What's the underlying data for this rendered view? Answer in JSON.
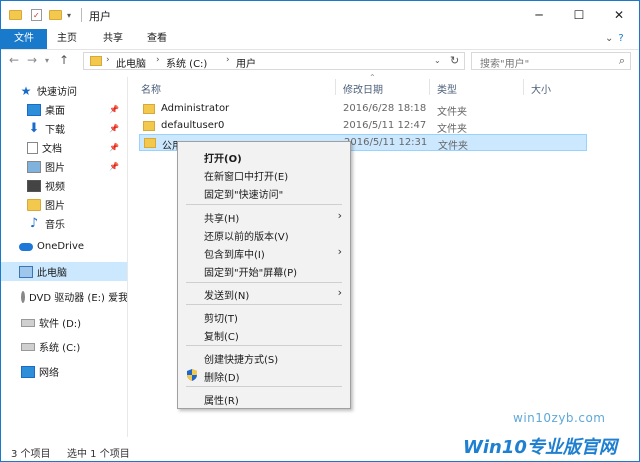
{
  "window": {
    "title": "用户",
    "controls": {
      "minimize": "─",
      "maximize": "☐",
      "close": "✕"
    }
  },
  "ribbon": {
    "tabs": [
      "文件",
      "主页",
      "共享",
      "查看"
    ],
    "expand": "⌄",
    "help": "?"
  },
  "address": {
    "crumbs": [
      "此电脑",
      "系统 (C:)",
      "用户"
    ],
    "search_placeholder": "搜索\"用户\""
  },
  "nav": {
    "items": [
      {
        "label": "快速访问",
        "icon": "star-icon"
      },
      {
        "label": "桌面",
        "icon": "desktop-icon",
        "pinned": true
      },
      {
        "label": "下载",
        "icon": "download-icon",
        "pinned": true
      },
      {
        "label": "文档",
        "icon": "documents-icon",
        "pinned": true
      },
      {
        "label": "图片",
        "icon": "pictures-icon",
        "pinned": true
      },
      {
        "label": "视频",
        "icon": "video-icon"
      },
      {
        "label": "图片",
        "icon": "folder-icon"
      },
      {
        "label": "音乐",
        "icon": "music-icon"
      },
      {
        "label": "OneDrive",
        "icon": "cloud-icon"
      },
      {
        "label": "此电脑",
        "icon": "computer-icon",
        "selected": true
      },
      {
        "label": "DVD 驱动器 (E:) 爱我",
        "icon": "dvd-icon"
      },
      {
        "label": "软件 (D:)",
        "icon": "drive-icon"
      },
      {
        "label": "系统 (C:)",
        "icon": "drive-icon"
      },
      {
        "label": "网络",
        "icon": "network-icon"
      }
    ]
  },
  "list": {
    "columns": [
      "名称",
      "修改日期",
      "类型",
      "大小"
    ],
    "rows": [
      {
        "name": "Administrator",
        "date": "2016/6/28 18:18",
        "type": "文件夹"
      },
      {
        "name": "defaultuser0",
        "date": "2016/5/11 12:47",
        "type": "文件夹"
      },
      {
        "name": "公用",
        "date": "2016/5/11 12:31",
        "type": "文件夹",
        "selected": true
      }
    ]
  },
  "context_menu": {
    "items": [
      {
        "label": "打开(O)",
        "bold": true
      },
      {
        "label": "在新窗口中打开(E)"
      },
      {
        "label": "固定到\"快速访问\""
      },
      {
        "label": "共享(H)",
        "submenu": true
      },
      {
        "label": "还原以前的版本(V)"
      },
      {
        "label": "包含到库中(I)",
        "submenu": true
      },
      {
        "label": "固定到\"开始\"屏幕(P)"
      },
      {
        "label": "发送到(N)",
        "submenu": true
      },
      {
        "label": "剪切(T)"
      },
      {
        "label": "复制(C)"
      },
      {
        "label": "创建快捷方式(S)"
      },
      {
        "label": "删除(D)",
        "icon": "shield-icon"
      },
      {
        "label": "属性(R)"
      }
    ]
  },
  "status": {
    "count": "3 个项目",
    "selected": "选中 1 个项目"
  },
  "watermark": {
    "site": "win10zyb.com",
    "logo": "Win10专业版官网"
  },
  "colors": {
    "accent": "#1979ca",
    "selection": "#cce8ff",
    "folder": "#f2c94c"
  }
}
